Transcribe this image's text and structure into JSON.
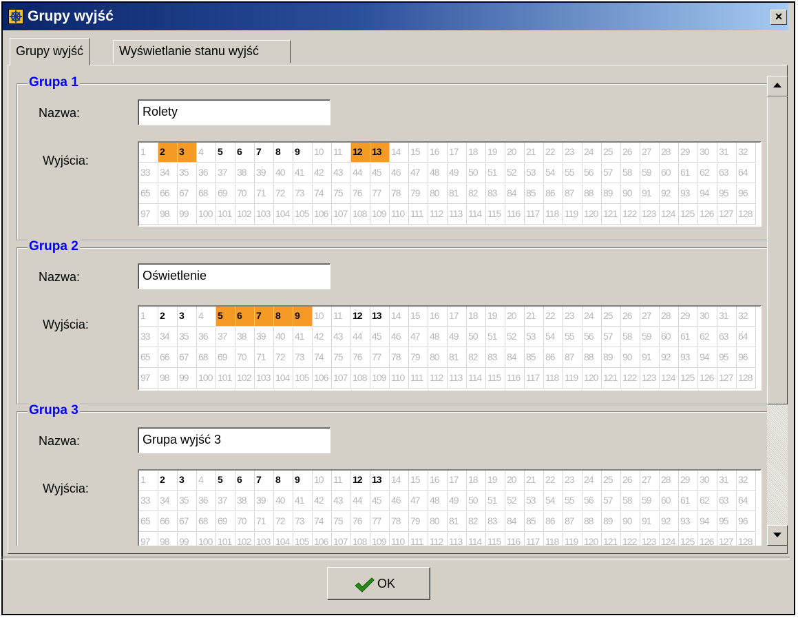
{
  "window": {
    "title": "Grupy wyjść",
    "close_label": "×",
    "colors": {
      "titlebar_start": "#0a246a",
      "titlebar_end": "#a6caf0",
      "selected_cell": "#f59b25",
      "group_title": "#0000ff"
    }
  },
  "tabs": [
    {
      "label": "Grupy wyjść",
      "active": true
    },
    {
      "label": "Wyświetlanie stanu wyjść",
      "active": false
    }
  ],
  "labels": {
    "name": "Nazwa:",
    "outputs": "Wyjścia:"
  },
  "groups": [
    {
      "title": "Grupa 1",
      "name_value": "Rolety",
      "selected_outputs": [
        2,
        3,
        12,
        13
      ]
    },
    {
      "title": "Grupa 2",
      "name_value": "Oświetlenie",
      "selected_outputs": [
        5,
        6,
        7,
        8,
        9
      ]
    },
    {
      "title": "Grupa 3",
      "name_value": "Grupa wyjść 3",
      "selected_outputs": []
    }
  ],
  "available_outputs": [
    2,
    3,
    5,
    6,
    7,
    8,
    9,
    12,
    13
  ],
  "outputs_total": 128,
  "buttons": {
    "ok_label": "OK",
    "ok_icon": "checkmark-icon"
  },
  "scrollbar": {
    "up_icon": "arrow-up-icon",
    "down_icon": "arrow-down-icon"
  }
}
